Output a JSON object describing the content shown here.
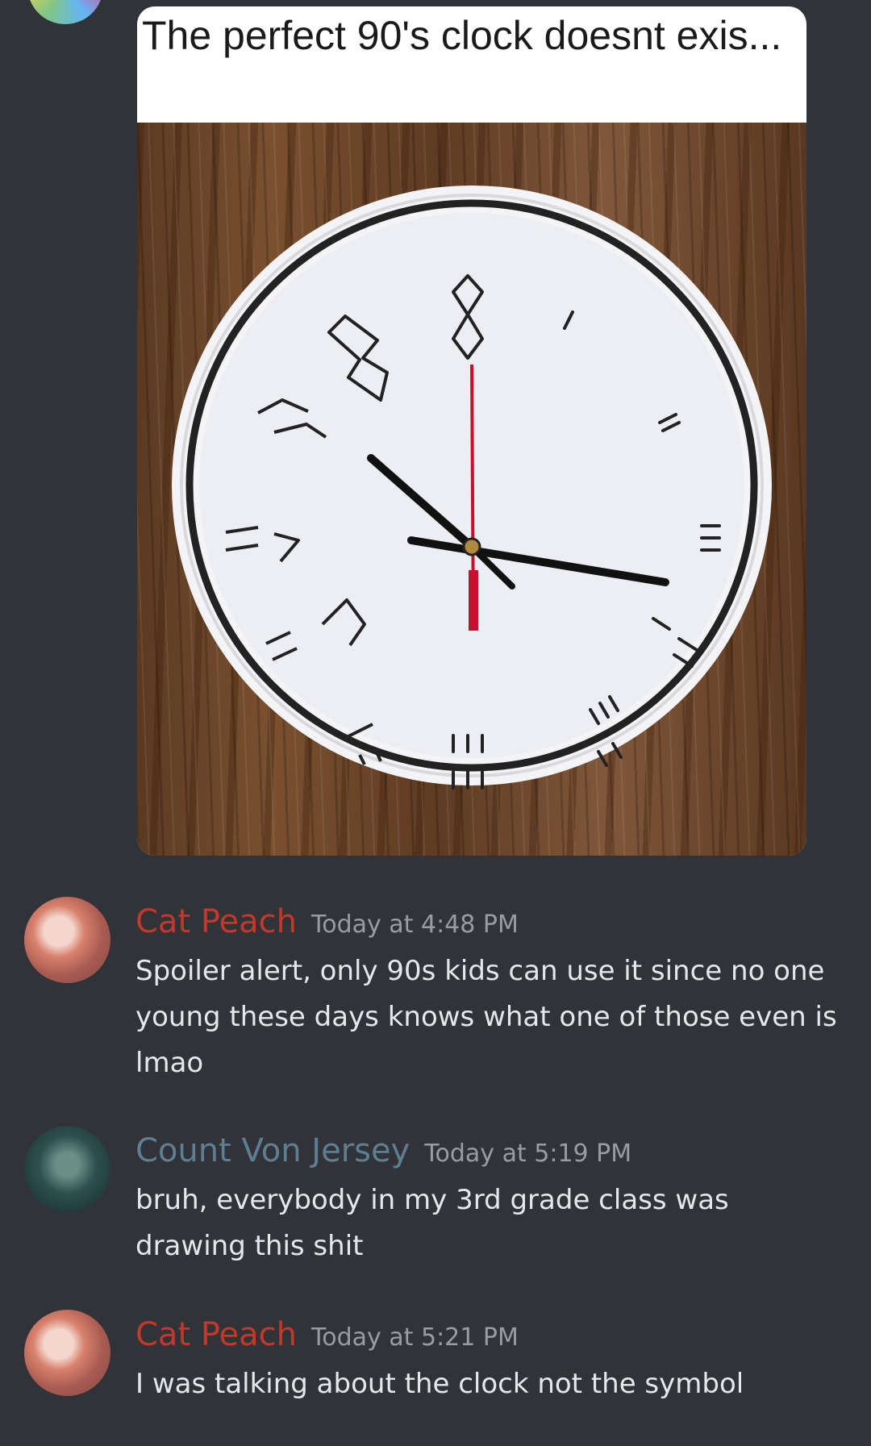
{
  "embed": {
    "caption": "The perfect 90's clock doesnt exis..."
  },
  "colors": {
    "background": "#313338",
    "cat_peach": "#c0392b",
    "count_von_jersey": "#5d7f93",
    "timestamp": "#9a9ca4",
    "message_text": "#e6e7ea"
  },
  "messages": [
    {
      "username": "Cat Peach",
      "timestamp": "Today at 4:48 PM",
      "text": "Spoiler alert, only 90s kids can use it since no one young these days knows what one of those even is lmao",
      "avatar": "cat-peach-avatar"
    },
    {
      "username": "Count Von Jersey",
      "timestamp": "Today at 5:19 PM",
      "text": "bruh, everybody in my 3rd grade class was drawing this shit",
      "avatar": "count-von-jersey-avatar"
    },
    {
      "username": "Cat Peach",
      "timestamp": "Today at 5:21 PM",
      "text": "I was talking about the clock not the symbol",
      "avatar": "cat-peach-avatar"
    }
  ]
}
